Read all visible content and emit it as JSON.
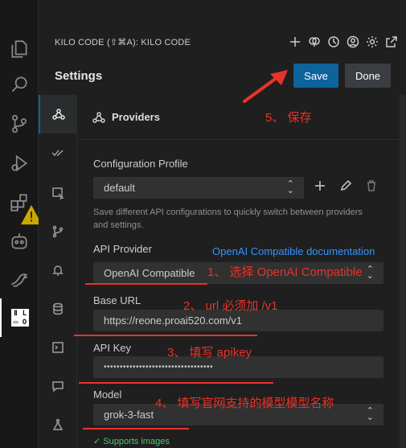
{
  "panel": {
    "title": "KILO CODE (⇧⌘A): KILO CODE",
    "settings_title": "Settings",
    "save_label": "Save",
    "done_label": "Done"
  },
  "section": {
    "providers_label": "Providers"
  },
  "form": {
    "config_profile_label": "Configuration Profile",
    "config_profile_value": "default",
    "config_profile_help": "Save different API configurations to quickly switch between providers and settings.",
    "api_provider_label": "API Provider",
    "api_provider_doc_link": "OpenAI Compatible documentation",
    "api_provider_value": "OpenAI Compatible",
    "base_url_label": "Base URL",
    "base_url_value": "https://reone.proai520.com/v1",
    "api_key_label": "API Key",
    "api_key_value": "••••••••••••••••••••••••••••••••••",
    "model_label": "Model",
    "model_value": "grok-3-fast",
    "supports_images": "✓ Supports images"
  },
  "annotations": {
    "step1": "1、 选择 OpenAI Compatible",
    "step2": "2、 url 必须加 /v1",
    "step3": "3、 填写 apikey",
    "step4": "4、 填写官网支持的模型模型名称",
    "step5": "5、 保存",
    "color": "#e8332a"
  },
  "icons": {
    "activity_bar": [
      "files-icon",
      "search-icon",
      "source-control-icon",
      "run-debug-icon",
      "extensions-icon",
      "copilot-icon",
      "kangaroo-icon",
      "kilo-code-icon"
    ],
    "settings_tabs": [
      "providers-icon",
      "auto-approve-icon",
      "browser-icon",
      "checkpoints-icon",
      "notifications-icon",
      "context-icon",
      "terminal-icon",
      "prompts-icon",
      "experimental-icon"
    ],
    "header": [
      "plus-icon",
      "brain-icon",
      "history-icon",
      "account-icon",
      "gear-icon",
      "popout-icon"
    ]
  },
  "colors": {
    "accent": "#0e639c",
    "link": "#3794ff",
    "success": "#4ec96f"
  }
}
